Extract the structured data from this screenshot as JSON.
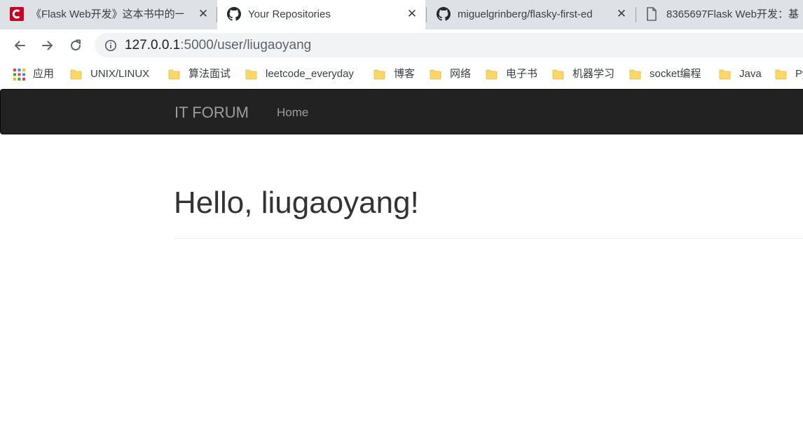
{
  "browser": {
    "tabs": [
      {
        "title": "《Flask Web开发》这本书中的一",
        "favicon": "csdn-icon",
        "active": false
      },
      {
        "title": "Your Repositories",
        "favicon": "github-icon",
        "active": true
      },
      {
        "title": "miguelgrinberg/flasky-first-ed",
        "favicon": "github-icon",
        "active": false
      },
      {
        "title": "8365697Flask Web开发：基",
        "favicon": "document-icon",
        "active": false
      }
    ],
    "address": {
      "host": "127.0.0.1",
      "path": ":5000/user/liugaoyang"
    },
    "bookmarks": [
      {
        "label": "应用",
        "icon": "apps-grid-icon"
      },
      {
        "label": "UNIX/LINUX",
        "icon": "folder-icon"
      },
      {
        "label": "算法面试",
        "icon": "folder-icon"
      },
      {
        "label": "leetcode_everyday",
        "icon": "folder-icon"
      },
      {
        "label": "博客",
        "icon": "folder-icon"
      },
      {
        "label": "网络",
        "icon": "folder-icon"
      },
      {
        "label": "电子书",
        "icon": "folder-icon"
      },
      {
        "label": "机器学习",
        "icon": "folder-icon"
      },
      {
        "label": "socket编程",
        "icon": "folder-icon"
      },
      {
        "label": "Java",
        "icon": "folder-icon"
      },
      {
        "label": "Py",
        "icon": "folder-icon"
      }
    ]
  },
  "site": {
    "brand": "IT FORUM",
    "nav": {
      "home": "Home"
    },
    "greeting": "Hello, liugaoyang!"
  },
  "colors": {
    "navbar_bg": "#222222",
    "navbar_text": "#9d9d9d",
    "heading_text": "#333333",
    "tabstrip_bg": "#dee1e6",
    "csdn_red": "#c9001f",
    "folder_yellow": "#fcd667"
  }
}
